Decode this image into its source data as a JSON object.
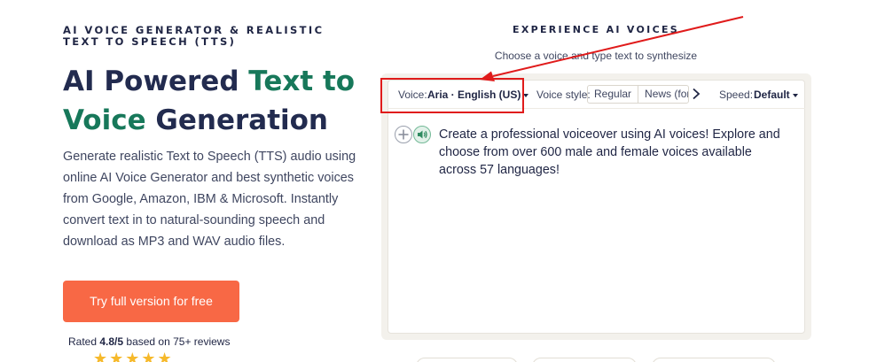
{
  "hero": {
    "eyebrow": "AI VOICE GENERATOR & REALISTIC TEXT TO SPEECH (TTS)",
    "title_part1": "AI Powered ",
    "title_accent1": "Text to",
    "title_accent2": "Voice",
    "title_part2": " Generation",
    "description": "Generate realistic Text to Speech (TTS) audio using online AI Voice Generator and best synthetic voices from Google, Amazon, IBM & Microsoft. Instantly convert text in to natural-sounding speech and download as MP3 and WAV audio files.",
    "cta_label": "Try full version for free",
    "rating_prefix": "Rated ",
    "rating_value": "4.8/5",
    "rating_suffix": " based on 75+ reviews",
    "stars": "★★★★★"
  },
  "panel": {
    "title": "EXPERIENCE AI VOICES",
    "subtitle": "Choose a voice and type text to synthesize",
    "voice_label": "Voice:",
    "voice_value": "Aria · English (US)",
    "style_label": "Voice style:",
    "style_options": [
      "Regular",
      "News (form"
    ],
    "speed_label": "Speed:",
    "speed_value": "Default",
    "editor_text": "Create a professional voiceover using AI voices! Explore and choose from over 600 male and female voices available across 57 languages!"
  },
  "colors": {
    "accent_green": "#17785a",
    "cta_orange": "#f86845",
    "annotation_red": "#e01b1b",
    "star_gold": "#f6b92b"
  },
  "icons": {
    "add": "plus-circle-icon",
    "play": "speaker-icon",
    "next": "chevron-right-icon",
    "dropdown": "caret-down-icon"
  }
}
